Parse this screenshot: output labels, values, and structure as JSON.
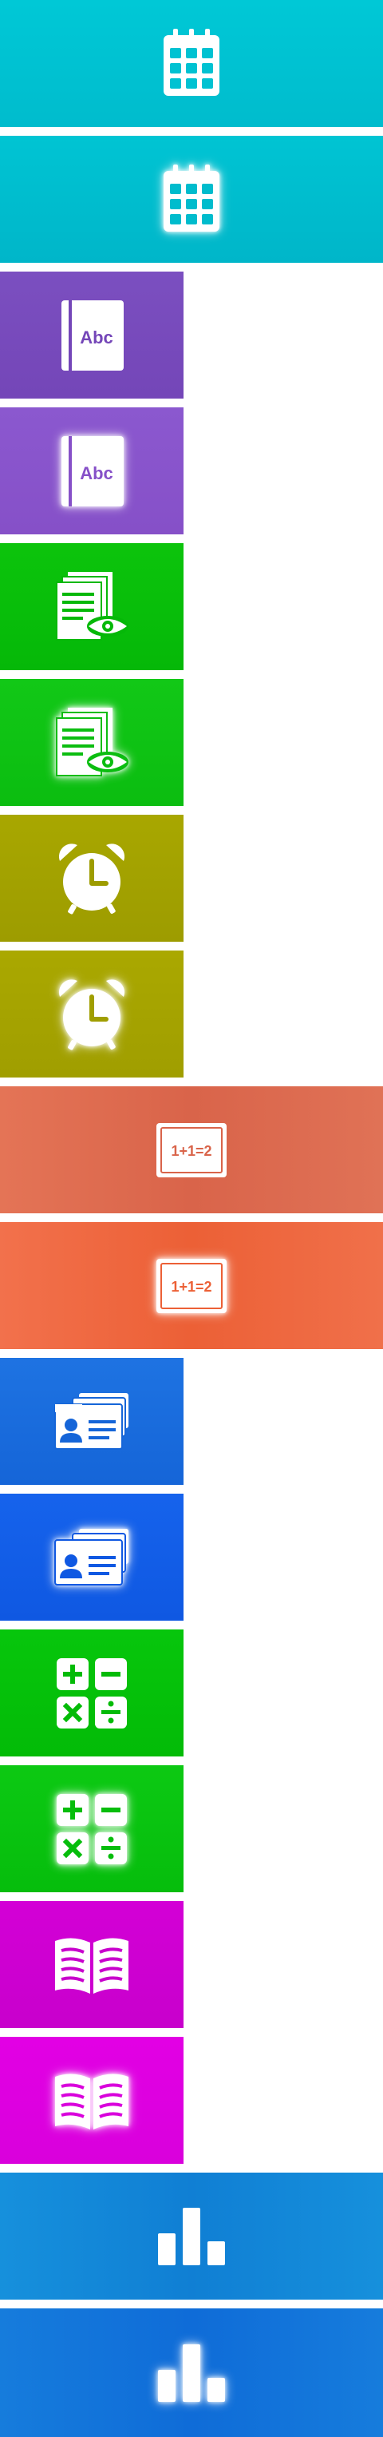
{
  "tiles": [
    {
      "id": "calendar-1",
      "icon": "calendar-icon",
      "color": "#00c5d4",
      "state": "normal"
    },
    {
      "id": "calendar-2",
      "icon": "calendar-icon",
      "color": "#00bdd0",
      "state": "highlighted"
    },
    {
      "id": "dictionary-1",
      "icon": "abc-book-icon",
      "color": "#7c4dbe",
      "label": "Abc",
      "state": "normal"
    },
    {
      "id": "dictionary-2",
      "icon": "abc-book-icon",
      "color": "#8a55cc",
      "label": "Abc",
      "state": "highlighted"
    },
    {
      "id": "preview-1",
      "icon": "document-eye-icon",
      "color": "#0bc00b",
      "state": "normal"
    },
    {
      "id": "preview-2",
      "icon": "document-eye-icon",
      "color": "#11c617",
      "state": "highlighted"
    },
    {
      "id": "alarm-1",
      "icon": "alarm-clock-icon",
      "color": "#a6a500",
      "state": "normal"
    },
    {
      "id": "alarm-2",
      "icon": "alarm-clock-icon",
      "color": "#a9a600",
      "state": "highlighted"
    },
    {
      "id": "math-1",
      "icon": "math-board-icon",
      "color": "#e06b4e",
      "label": "1+1=2",
      "state": "normal"
    },
    {
      "id": "math-2",
      "icon": "math-board-icon",
      "color": "#f0663c",
      "label": "1+1=2",
      "state": "highlighted"
    },
    {
      "id": "contacts-1",
      "icon": "id-card-icon",
      "color": "#1b6fe0",
      "state": "normal"
    },
    {
      "id": "contacts-2",
      "icon": "id-card-icon",
      "color": "#1460ea",
      "state": "highlighted"
    },
    {
      "id": "calculator-1",
      "icon": "calculator-icon",
      "color": "#06c40b",
      "state": "normal"
    },
    {
      "id": "calculator-2",
      "icon": "calculator-icon",
      "color": "#0bc712",
      "state": "highlighted"
    },
    {
      "id": "reader-1",
      "icon": "open-book-icon",
      "color": "#d200d6",
      "state": "normal"
    },
    {
      "id": "reader-2",
      "icon": "open-book-icon",
      "color": "#e000e0",
      "state": "highlighted"
    },
    {
      "id": "stats-1",
      "icon": "bar-chart-icon",
      "color": "#1385d8",
      "state": "normal"
    },
    {
      "id": "stats-2",
      "icon": "bar-chart-icon",
      "color": "#1472dc",
      "state": "highlighted"
    }
  ]
}
